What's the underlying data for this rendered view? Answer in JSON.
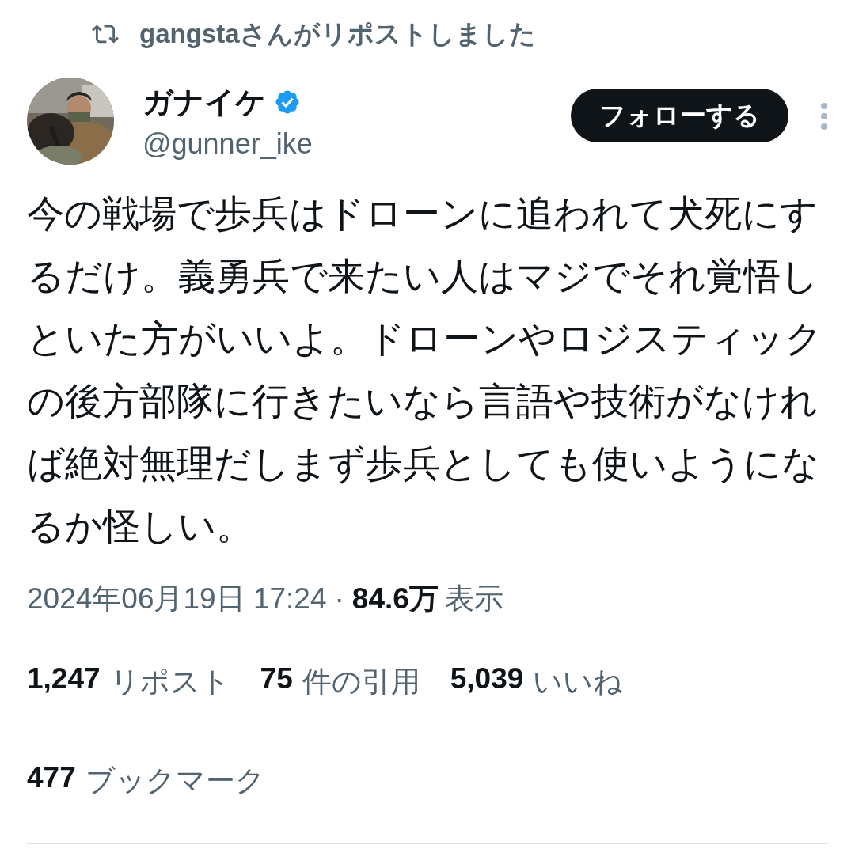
{
  "repost_banner": {
    "text": "gangstaさんがリポストしました"
  },
  "author": {
    "name": "ガナイケ",
    "verified": true,
    "handle": "@gunner_ike"
  },
  "follow_button": {
    "label": "フォローする"
  },
  "tweet_text": "今の戦場で歩兵はドローンに追われて犬死にするだけ。義勇兵で来たい人はマジでそれ覚悟しといた方がいいよ。ドローンやロジスティックの後方部隊に行きたいなら言語や技術がなければ絶対無理だしまず歩兵としても使いようになるか怪しい。",
  "meta": {
    "timestamp": "2024年06月19日 17:24",
    "separator": "·",
    "views_count": "84.6万",
    "views_label": "表示"
  },
  "stats": [
    {
      "count": "1,247",
      "label": "リポスト"
    },
    {
      "count": "75",
      "label": "件の引用"
    },
    {
      "count": "5,039",
      "label": "いいね"
    }
  ],
  "bookmarks": {
    "count": "477",
    "label": "ブックマーク"
  }
}
